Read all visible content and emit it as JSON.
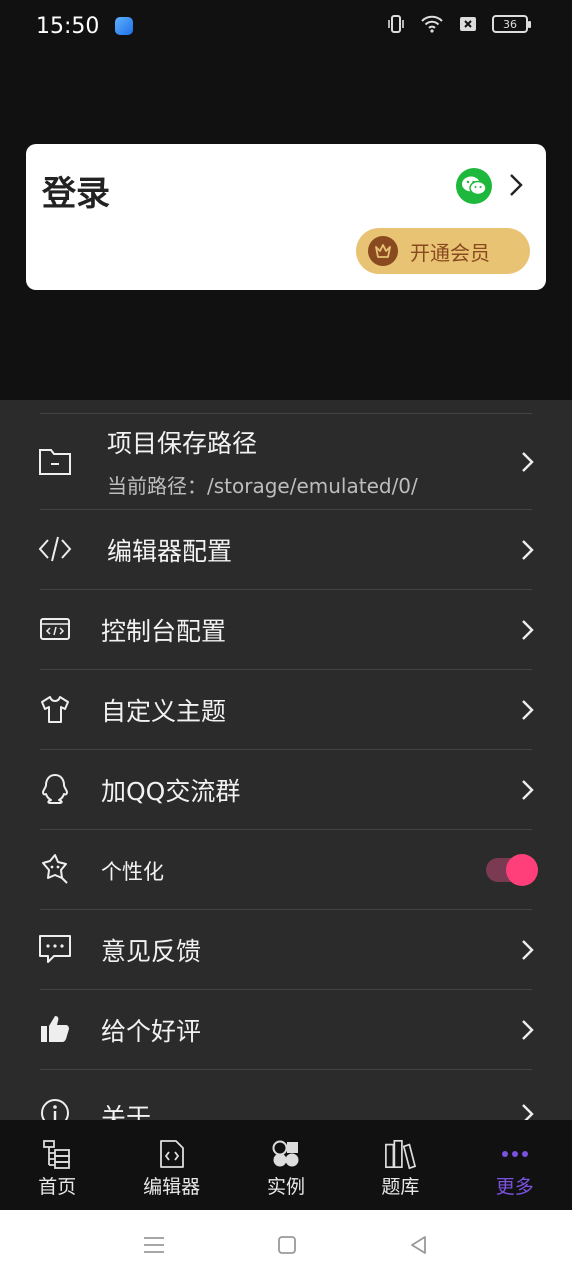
{
  "status": {
    "time": "15:50",
    "battery": "36"
  },
  "login": {
    "title": "登录",
    "vip_label": "开通会员"
  },
  "settings": {
    "items": [
      {
        "label": "项目保存路径",
        "sub": "当前路径：/storage/emulated/0/"
      },
      {
        "label": "编辑器配置"
      },
      {
        "label": "控制台配置"
      },
      {
        "label": "自定义主题"
      },
      {
        "label": "加QQ交流群"
      },
      {
        "label": "个性化"
      },
      {
        "label": "意见反馈"
      },
      {
        "label": "给个好评"
      },
      {
        "label": "关于"
      }
    ],
    "personalize_toggle_on": true
  },
  "nav": {
    "items": [
      {
        "label": "首页"
      },
      {
        "label": "编辑器"
      },
      {
        "label": "实例"
      },
      {
        "label": "题库"
      },
      {
        "label": "更多"
      }
    ],
    "active_index": 4
  },
  "colors": {
    "accent": "#7b52e0",
    "toggle": "#ff3f7a",
    "vip": "#e8c374",
    "wechat": "#1db83c"
  }
}
